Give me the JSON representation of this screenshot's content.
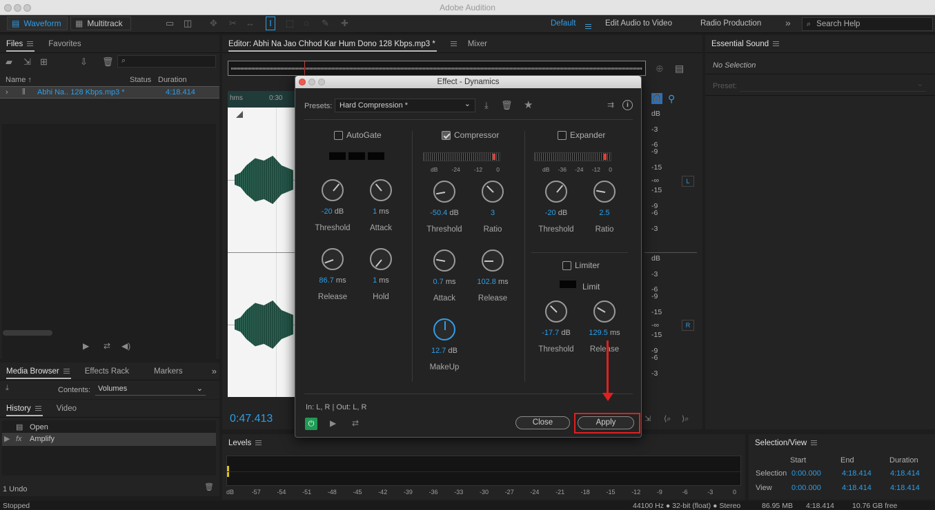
{
  "app_title": "Adobe Audition",
  "toolbar": {
    "waveform": "Waveform",
    "multitrack": "Multitrack",
    "workspaces": [
      "Default",
      "Edit Audio to Video",
      "Radio Production"
    ],
    "more": "»",
    "search_placeholder": "Search Help"
  },
  "files_panel": {
    "tabs": [
      "Files",
      "Favorites"
    ],
    "columns": {
      "name": "Name",
      "sort_arrow": "↑",
      "status": "Status",
      "duration": "Duration"
    },
    "file": {
      "name": "Abhi Na.. 128 Kbps.mp3 *",
      "duration": "4:18.414"
    }
  },
  "media_panel": {
    "tabs": [
      "Media Browser",
      "Effects Rack",
      "Markers"
    ],
    "contents_label": "Contents:",
    "contents_value": "Volumes"
  },
  "history_panel": {
    "tabs": [
      "History",
      "Video"
    ],
    "items": [
      {
        "icon": "document-icon",
        "label": "Open"
      },
      {
        "icon": "fx-icon",
        "label": "Amplify"
      }
    ],
    "undo_count": "1 Undo"
  },
  "editor": {
    "tab": "Editor: Abhi Na Jao Chhod Kar Hum Dono 128 Kbps.mp3 *",
    "mixer_tab": "Mixer",
    "ruler": [
      "hms",
      "0:30"
    ],
    "timecode": "0:47.413",
    "db_scale_top": [
      "dB",
      "-3",
      "-6",
      "-9",
      "-15",
      "-∞",
      "-15",
      "-9",
      "-6",
      "-3"
    ],
    "db_scale_bottom": [
      "dB",
      "-3",
      "-6",
      "-9",
      "-15",
      "-∞",
      "-15",
      "-9",
      "-6",
      "-3"
    ],
    "channel_left": "L",
    "channel_right": "R"
  },
  "essential_sound": {
    "title": "Essential Sound",
    "no_selection": "No Selection",
    "preset_label": "Preset:"
  },
  "levels": {
    "title": "Levels",
    "scale": [
      "dB",
      "-57",
      "-54",
      "-51",
      "-48",
      "-45",
      "-42",
      "-39",
      "-36",
      "-33",
      "-30",
      "-27",
      "-24",
      "-21",
      "-18",
      "-15",
      "-12",
      "-9",
      "-6",
      "-3",
      "0"
    ]
  },
  "selection_view": {
    "title": "Selection/View",
    "headers": [
      "Start",
      "End",
      "Duration"
    ],
    "rows": [
      {
        "label": "Selection",
        "start": "0:00.000",
        "end": "4:18.414",
        "duration": "4:18.414"
      },
      {
        "label": "View",
        "start": "0:00.000",
        "end": "4:18.414",
        "duration": "4:18.414"
      }
    ]
  },
  "status_bar": {
    "left": "Stopped",
    "format": "44100 Hz ● 32-bit (float) ● Stereo",
    "size": "86.95 MB",
    "duration": "4:18.414",
    "free": "10.76 GB free"
  },
  "dialog": {
    "title": "Effect - Dynamics",
    "presets_label": "Presets:",
    "preset_value": "Hard Compression *",
    "autogate": {
      "label": "AutoGate",
      "checked": false,
      "knobs": [
        {
          "value": "-20",
          "unit": "dB",
          "label": "Threshold"
        },
        {
          "value": "1",
          "unit": "ms",
          "label": "Attack"
        },
        {
          "value": "86.7",
          "unit": "ms",
          "label": "Release"
        },
        {
          "value": "1",
          "unit": "ms",
          "label": "Hold"
        }
      ]
    },
    "compressor": {
      "label": "Compressor",
      "checked": true,
      "meter_scale": [
        "dB",
        "-24",
        "-12",
        "0"
      ],
      "knobs": [
        {
          "value": "-50.4",
          "unit": "dB",
          "label": "Threshold"
        },
        {
          "value": "3",
          "unit": "",
          "label": "Ratio"
        },
        {
          "value": "0.7",
          "unit": "ms",
          "label": "Attack"
        },
        {
          "value": "102.8",
          "unit": "ms",
          "label": "Release"
        },
        {
          "value": "12.7",
          "unit": "dB",
          "label": "MakeUp"
        }
      ]
    },
    "expander": {
      "label": "Expander",
      "checked": false,
      "meter_scale": [
        "dB",
        "-36",
        "-24",
        "-12",
        "0"
      ],
      "knobs": [
        {
          "value": "-20",
          "unit": "dB",
          "label": "Threshold"
        },
        {
          "value": "2.5",
          "unit": "",
          "label": "Ratio"
        }
      ]
    },
    "limiter": {
      "label": "Limiter",
      "checked": false,
      "limit_label": "Limit",
      "knobs": [
        {
          "value": "-17.7",
          "unit": "dB",
          "label": "Threshold"
        },
        {
          "value": "129.5",
          "unit": "ms",
          "label": "Release"
        }
      ]
    },
    "io_label": "In: L, R | Out: L, R",
    "close_label": "Close",
    "apply_label": "Apply",
    "highlight_color": "#e02020"
  }
}
